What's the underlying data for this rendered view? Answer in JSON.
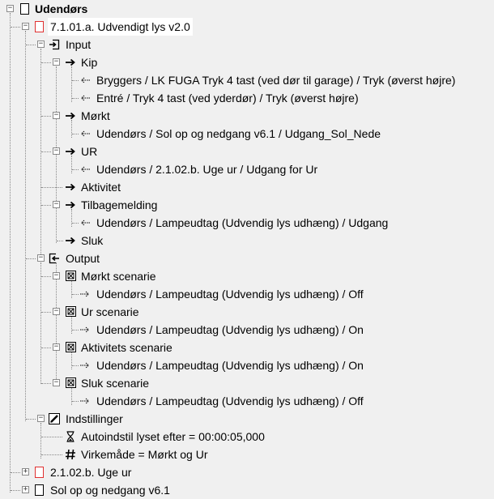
{
  "tree": {
    "root": {
      "label": "Udendørs"
    },
    "block1": {
      "label": "7.1.01.a. Udvendigt lys v2.0",
      "input": {
        "label": "Input",
        "kip": {
          "label": "Kip",
          "links": [
            "Bryggers / LK FUGA Tryk 4 tast (ved dør til garage)  / Tryk (øverst højre)",
            "Entré / Tryk 4 tast (ved yderdør)  / Tryk (øverst højre)"
          ]
        },
        "morkt": {
          "label": "Mørkt",
          "links": [
            "Udendørs / Sol op og nedgang v6.1 / Udgang_Sol_Nede"
          ]
        },
        "ur": {
          "label": "UR",
          "links": [
            "Udendørs / 2.1.02.b. Uge ur / Udgang for Ur"
          ]
        },
        "aktivitet": {
          "label": "Aktivitet"
        },
        "tilbage": {
          "label": "Tilbagemelding",
          "links": [
            "Udendørs / Lampeudtag (Udvendig lys udhæng)  / Udgang"
          ]
        },
        "sluk": {
          "label": "Sluk"
        }
      },
      "output": {
        "label": "Output",
        "morkt": {
          "label": "Mørkt scenarie",
          "links": [
            "Udendørs / Lampeudtag (Udvendig lys udhæng)  / Off"
          ]
        },
        "ur": {
          "label": "Ur scenarie",
          "links": [
            "Udendørs / Lampeudtag (Udvendig lys udhæng)  / On"
          ]
        },
        "aktivitet": {
          "label": "Aktivitets scenarie",
          "links": [
            "Udendørs / Lampeudtag (Udvendig lys udhæng)  / On"
          ]
        },
        "sluk": {
          "label": "Sluk scenarie",
          "links": [
            "Udendørs / Lampeudtag (Udvendig lys udhæng)  / Off"
          ]
        }
      },
      "settings": {
        "label": "Indstillinger",
        "autoindstil": "Autoindstil lyset efter = 00:00:05,000",
        "virkemade": "Virkemåde = Mørkt og Ur"
      }
    },
    "block2": {
      "label": "2.1.02.b. Uge ur"
    },
    "block3": {
      "label": "Sol op og nedgang v6.1"
    }
  },
  "colors": {
    "block_icon": "#e03030",
    "background": "#f0f0f0"
  },
  "icons": {
    "root": "page-icon",
    "block": "red-block-icon",
    "input": "input-icon",
    "input_item": "arrow-right-icon",
    "link_in": "link-in-icon",
    "output": "output-icon",
    "scenario": "scenario-icon",
    "link_out": "link-out-icon",
    "settings": "pencil-icon",
    "timer": "hourglass-icon",
    "mode": "hash-icon"
  }
}
